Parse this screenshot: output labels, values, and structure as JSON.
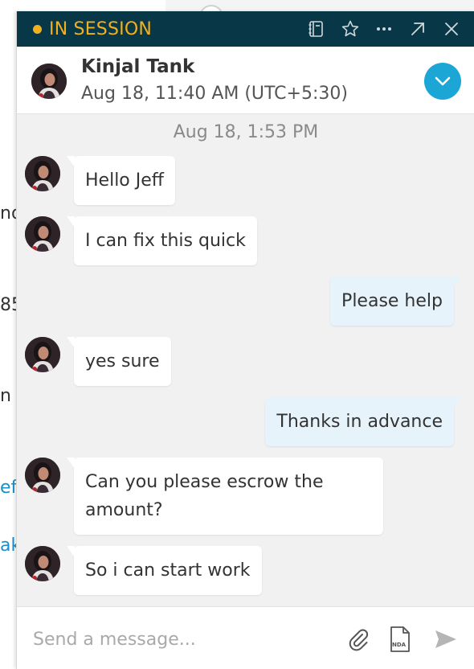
{
  "background": {
    "fragments": [
      "nd",
      "85",
      "n",
      "ef",
      "ak"
    ]
  },
  "window": {
    "status_label": "IN SESSION",
    "status_color": "#f2b01e",
    "titlebar_color": "#083848",
    "icons": [
      "notebook-icon",
      "star-icon",
      "more-icon",
      "popout-icon",
      "close-icon"
    ]
  },
  "contact": {
    "name": "Kinjal Tank",
    "local_time": "Aug 18, 11:40 AM (UTC+5:30)"
  },
  "conversation": {
    "date_separator": "Aug 18, 1:53 PM",
    "messages": [
      {
        "from": "contact",
        "text": "Hello Jeff"
      },
      {
        "from": "contact",
        "text": "I can fix this quick"
      },
      {
        "from": "me",
        "text": "Please help"
      },
      {
        "from": "contact",
        "text": "yes sure"
      },
      {
        "from": "me",
        "text": "Thanks in advance"
      },
      {
        "from": "contact",
        "text": "Can you please escrow the amount?"
      },
      {
        "from": "contact",
        "text": "So i can start work"
      }
    ]
  },
  "composer": {
    "placeholder": "Send a message...",
    "nda_label": "NDA"
  },
  "colors": {
    "accent": "#1ba6d6",
    "outgoing_bubble": "#e6f3fb",
    "incoming_bubble": "#ffffff"
  }
}
